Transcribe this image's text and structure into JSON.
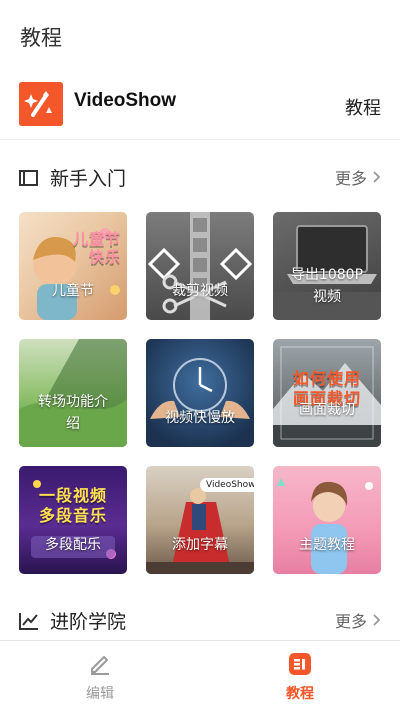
{
  "header": {
    "title": "教程"
  },
  "app": {
    "name": "VideoShow",
    "right_label": "教程",
    "icon": "wand-icon",
    "brand_color": "#f4582a"
  },
  "sections": [
    {
      "title": "新手入门",
      "more": "更多",
      "icon": "book-icon"
    },
    {
      "title": "进阶学院",
      "more": "更多",
      "icon": "chart-icon"
    }
  ],
  "tiles": [
    {
      "label": "儿童节",
      "deco": "儿童节 快乐",
      "thumb": "child-photo"
    },
    {
      "label": "裁剪视频",
      "thumb": "scissors-film"
    },
    {
      "label": "导出1080P 视频",
      "thumb": "laptop-desk"
    },
    {
      "label": "转场功能介 绍",
      "thumb": "green-landscape"
    },
    {
      "label": "视频快慢放",
      "thumb": "clock-hands"
    },
    {
      "label": "画面裁切",
      "deco": "如何使用 画面裁切",
      "thumb": "mountain"
    },
    {
      "label": "多段配乐",
      "deco": "一段视频 多段音乐",
      "thumb": "purple-poster"
    },
    {
      "label": "添加字幕",
      "deco": "VideoShow",
      "thumb": "hero-cape"
    },
    {
      "label": "主题教程",
      "thumb": "girl-pink"
    }
  ],
  "tabbar": {
    "items": [
      {
        "label": "编辑",
        "icon": "pencil-icon",
        "active": false
      },
      {
        "label": "教程",
        "icon": "tutorial-icon",
        "active": true
      }
    ],
    "active_color": "#f4582a",
    "inactive_color": "#9a9a9a"
  }
}
